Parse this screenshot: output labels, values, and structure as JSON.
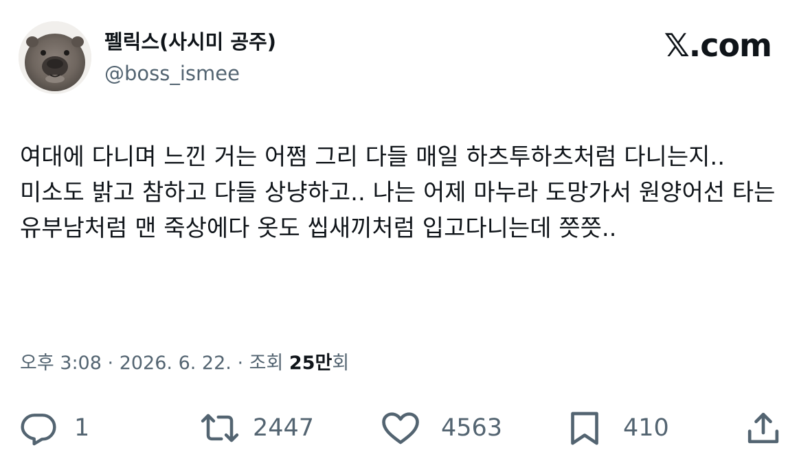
{
  "user": {
    "display_name": "펠릭스(사시미 공주)",
    "handle": "@boss_ismee"
  },
  "brand": {
    "label": "𝕏.com"
  },
  "tweet": {
    "text": "여대에 다니며 느낀 거는 어쩜 그리 다들 매일 하츠투하츠처럼 다니는지.. 미소도 밝고 참하고 다들 상냥하고.. 나는 어제 마누라 도망가서 원양어선 타는 유부남처럼 맨 죽상에다 옷도 씹새끼처럼 입고다니는데 쯧쯧.."
  },
  "meta": {
    "time": "오후 3:08",
    "separator": "·",
    "date": "2026. 6. 22.",
    "views_prefix": "조회",
    "views_number": "25만",
    "views_suffix": "회"
  },
  "actions": {
    "reply_icon": "reply-icon",
    "reply_count": "1",
    "retweet_icon": "retweet-icon",
    "retweet_count": "2447",
    "like_icon": "heart-icon",
    "like_count": "4563",
    "bookmark_icon": "bookmark-icon",
    "bookmark_count": "410",
    "share_icon": "share-icon"
  },
  "colors": {
    "text_primary": "#0f1419",
    "text_secondary": "#536471",
    "background": "#ffffff"
  }
}
